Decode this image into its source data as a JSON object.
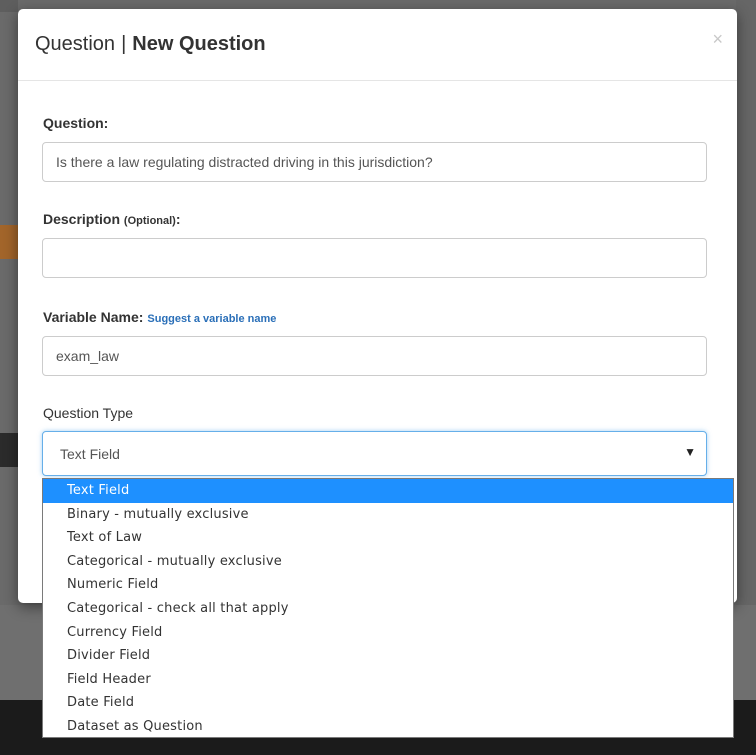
{
  "modal": {
    "title_prefix": "Question",
    "title_separator": "|",
    "title_main": "New Question",
    "close_label": "×"
  },
  "form": {
    "question": {
      "label": "Question:",
      "value": "Is there a law regulating distracted driving in this jurisdiction?"
    },
    "description": {
      "label": "Description",
      "optional_note": "(Optional)",
      "colon": ":",
      "value": ""
    },
    "variable_name": {
      "label": "Variable Name:",
      "suggest_link": "Suggest a variable name",
      "value": "exam_law"
    },
    "question_type": {
      "label": "Question Type",
      "selected": "Text Field",
      "arrow": "▼",
      "options": [
        "Text Field",
        "Binary - mutually exclusive",
        "Text of Law",
        "Categorical - mutually exclusive",
        "Numeric Field",
        "Categorical - check all that apply",
        "Currency Field",
        "Divider Field",
        "Field Header",
        "Date Field",
        "Dataset as Question"
      ],
      "highlighted_index": 0
    }
  },
  "colors": {
    "highlight": "#1e90ff",
    "link": "#2a6fb8",
    "focus_border": "#66afe9"
  }
}
